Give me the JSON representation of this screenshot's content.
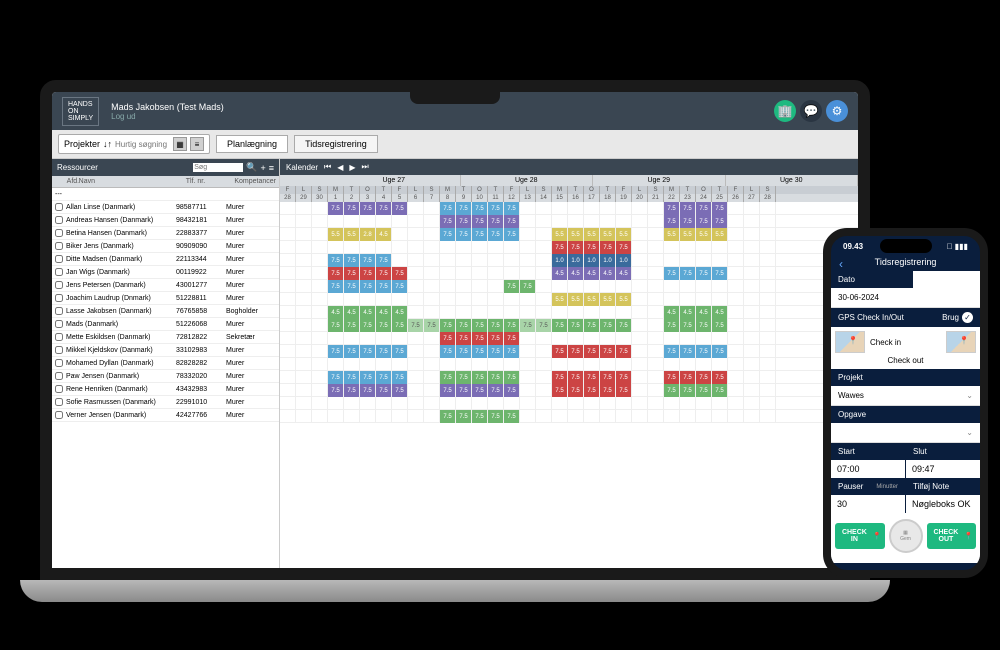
{
  "header": {
    "logo": "HANDS\nON\nSIMPLY",
    "user": "Mads Jakobsen (Test Mads)",
    "logout": "Log ud"
  },
  "tabs": {
    "projekter": "Projekter",
    "search_ph": "Hurtig søgning",
    "planlaegning": "Planlægning",
    "tidsregistrering": "Tidsregistrering"
  },
  "resources": {
    "title": "Ressourcer",
    "search_ph": "Søg",
    "cols": {
      "afd": "Afd.",
      "navn": "Navn",
      "tlf": "Tlf. nr.",
      "komp": "Kompetancer"
    },
    "rows": [
      {
        "n": "Allan Linse (Danmark)",
        "t": "98587711",
        "k": "Murer"
      },
      {
        "n": "Andreas Hansen (Danmark)",
        "t": "98432181",
        "k": "Murer"
      },
      {
        "n": "Betina Hansen (Danmark)",
        "t": "22883377",
        "k": "Murer"
      },
      {
        "n": "Biker Jens (Danmark)",
        "t": "90909090",
        "k": "Murer"
      },
      {
        "n": "Ditte Madsen (Danmark)",
        "t": "22113344",
        "k": "Murer"
      },
      {
        "n": "Jan Wigs (Danmark)",
        "t": "00119922",
        "k": "Murer"
      },
      {
        "n": "Jens Petersen (Danmark)",
        "t": "43001277",
        "k": "Murer"
      },
      {
        "n": "Joachim Laudrup (Dnmark)",
        "t": "51228811",
        "k": "Murer"
      },
      {
        "n": "Lasse Jakobsen (Danmark)",
        "t": "76765858",
        "k": "Bogholder"
      },
      {
        "n": "Mads (Danmark)",
        "t": "51226068",
        "k": "Murer"
      },
      {
        "n": "Mette Eskildsen (Danmark)",
        "t": "72812822",
        "k": "Sekretær"
      },
      {
        "n": "Mikkel Kjeldskov (Danmark)",
        "t": "33102983",
        "k": "Murer"
      },
      {
        "n": "Mohamed Dyllan (Danmark)",
        "t": "82828282",
        "k": "Murer"
      },
      {
        "n": "Paw Jensen (Danmark)",
        "t": "78332020",
        "k": "Murer"
      },
      {
        "n": "Rene Henriken (Danmark)",
        "t": "43432983",
        "k": "Murer"
      },
      {
        "n": "Sofie Rasmussen (Danmark)",
        "t": "22991010",
        "k": "Murer"
      },
      {
        "n": "Verner Jensen (Danmark)",
        "t": "42427766",
        "k": "Murer"
      }
    ]
  },
  "calendar": {
    "title": "Kalender",
    "weeks": [
      "Uge 27",
      "Uge 28",
      "Uge 29",
      "Uge 30"
    ],
    "daylabels": [
      "F",
      "L",
      "S",
      "M",
      "T",
      "O",
      "T",
      "F",
      "L",
      "S",
      "M",
      "T",
      "O",
      "T",
      "F",
      "L",
      "S",
      "M",
      "T",
      "O",
      "T",
      "F",
      "L",
      "S",
      "M",
      "T",
      "O",
      "T",
      "F",
      "L",
      "S"
    ],
    "daynums": [
      "28",
      "29",
      "30",
      "1",
      "2",
      "3",
      "4",
      "5",
      "6",
      "7",
      "8",
      "9",
      "10",
      "11",
      "12",
      "13",
      "14",
      "15",
      "16",
      "17",
      "18",
      "19",
      "20",
      "21",
      "22",
      "23",
      "24",
      "25",
      "26",
      "27",
      "28"
    ],
    "val": "7.5",
    "rows": [
      {
        "cells": [
          {
            "i": 3,
            "c": "p"
          },
          {
            "i": 4,
            "c": "p"
          },
          {
            "i": 5,
            "c": "p"
          },
          {
            "i": 6,
            "c": "p"
          },
          {
            "i": 7,
            "c": "p"
          },
          {
            "i": 10,
            "c": "b"
          },
          {
            "i": 11,
            "c": "b"
          },
          {
            "i": 12,
            "c": "b"
          },
          {
            "i": 13,
            "c": "b"
          },
          {
            "i": 14,
            "c": "b"
          },
          {
            "i": 24,
            "c": "p"
          },
          {
            "i": 25,
            "c": "p"
          },
          {
            "i": 26,
            "c": "p"
          },
          {
            "i": 27,
            "c": "p"
          }
        ]
      },
      {
        "cells": [
          {
            "i": 10,
            "c": "p"
          },
          {
            "i": 11,
            "c": "p"
          },
          {
            "i": 12,
            "c": "p"
          },
          {
            "i": 13,
            "c": "p"
          },
          {
            "i": 14,
            "c": "p"
          },
          {
            "i": 24,
            "c": "p"
          },
          {
            "i": 25,
            "c": "p"
          },
          {
            "i": 26,
            "c": "p"
          },
          {
            "i": 27,
            "c": "p"
          }
        ]
      },
      {
        "cells": [
          {
            "i": 3,
            "c": "y",
            "v": "5.5"
          },
          {
            "i": 4,
            "c": "y",
            "v": "5.5"
          },
          {
            "i": 5,
            "c": "y",
            "v": "2.8"
          },
          {
            "i": 6,
            "c": "y",
            "v": "4.5"
          },
          {
            "i": 10,
            "c": "b"
          },
          {
            "i": 11,
            "c": "b"
          },
          {
            "i": 12,
            "c": "b"
          },
          {
            "i": 13,
            "c": "b"
          },
          {
            "i": 14,
            "c": "b"
          },
          {
            "i": 17,
            "c": "y",
            "v": "5.5"
          },
          {
            "i": 18,
            "c": "y",
            "v": "5.5"
          },
          {
            "i": 19,
            "c": "y",
            "v": "5.5"
          },
          {
            "i": 20,
            "c": "y",
            "v": "5.5"
          },
          {
            "i": 21,
            "c": "y",
            "v": "5.5"
          },
          {
            "i": 24,
            "c": "y",
            "v": "5.5"
          },
          {
            "i": 25,
            "c": "y",
            "v": "5.5"
          },
          {
            "i": 26,
            "c": "y",
            "v": "5.5"
          },
          {
            "i": 27,
            "c": "y",
            "v": "5.5"
          }
        ]
      },
      {
        "cells": [
          {
            "i": 17,
            "c": "r"
          },
          {
            "i": 18,
            "c": "r"
          },
          {
            "i": 19,
            "c": "r"
          },
          {
            "i": 20,
            "c": "r"
          },
          {
            "i": 21,
            "c": "r"
          }
        ]
      },
      {
        "cells": [
          {
            "i": 3,
            "c": "b"
          },
          {
            "i": 4,
            "c": "b"
          },
          {
            "i": 5,
            "c": "b"
          },
          {
            "i": 6,
            "c": "b"
          },
          {
            "i": 17,
            "c": "db",
            "v": "1.0"
          },
          {
            "i": 18,
            "c": "db",
            "v": "1.0"
          },
          {
            "i": 19,
            "c": "db",
            "v": "1.0"
          },
          {
            "i": 20,
            "c": "db",
            "v": "1.0"
          },
          {
            "i": 21,
            "c": "db",
            "v": "1.0"
          }
        ]
      },
      {
        "cells": [
          {
            "i": 3,
            "c": "r"
          },
          {
            "i": 4,
            "c": "r"
          },
          {
            "i": 5,
            "c": "r"
          },
          {
            "i": 6,
            "c": "r"
          },
          {
            "i": 7,
            "c": "r"
          },
          {
            "i": 17,
            "c": "p",
            "v": "4.5"
          },
          {
            "i": 18,
            "c": "p",
            "v": "4.5"
          },
          {
            "i": 19,
            "c": "p",
            "v": "4.5"
          },
          {
            "i": 20,
            "c": "p",
            "v": "4.5"
          },
          {
            "i": 21,
            "c": "p",
            "v": "4.5"
          },
          {
            "i": 24,
            "c": "b"
          },
          {
            "i": 25,
            "c": "b"
          },
          {
            "i": 26,
            "c": "b"
          },
          {
            "i": 27,
            "c": "b"
          }
        ]
      },
      {
        "cells": [
          {
            "i": 3,
            "c": "b"
          },
          {
            "i": 4,
            "c": "b"
          },
          {
            "i": 5,
            "c": "b"
          },
          {
            "i": 6,
            "c": "b"
          },
          {
            "i": 7,
            "c": "b"
          },
          {
            "i": 14,
            "c": "g"
          },
          {
            "i": 15,
            "c": "g"
          }
        ]
      },
      {
        "cells": [
          {
            "i": 17,
            "c": "y",
            "v": "5.5"
          },
          {
            "i": 18,
            "c": "y",
            "v": "5.5"
          },
          {
            "i": 19,
            "c": "y",
            "v": "5.5"
          },
          {
            "i": 20,
            "c": "y",
            "v": "5.5"
          },
          {
            "i": 21,
            "c": "y",
            "v": "5.5"
          }
        ]
      },
      {
        "cells": [
          {
            "i": 3,
            "c": "g",
            "v": "4.5"
          },
          {
            "i": 4,
            "c": "g",
            "v": "4.5"
          },
          {
            "i": 5,
            "c": "g",
            "v": "4.5"
          },
          {
            "i": 6,
            "c": "g",
            "v": "4.5"
          },
          {
            "i": 7,
            "c": "g",
            "v": "4.5"
          },
          {
            "i": 24,
            "c": "g",
            "v": "4.5"
          },
          {
            "i": 25,
            "c": "g",
            "v": "4.5"
          },
          {
            "i": 26,
            "c": "g",
            "v": "4.5"
          },
          {
            "i": 27,
            "c": "g",
            "v": "4.5"
          }
        ]
      },
      {
        "cells": [
          {
            "i": 3,
            "c": "g"
          },
          {
            "i": 4,
            "c": "g"
          },
          {
            "i": 5,
            "c": "g"
          },
          {
            "i": 6,
            "c": "g"
          },
          {
            "i": 7,
            "c": "g"
          },
          {
            "i": 8,
            "c": "lg"
          },
          {
            "i": 9,
            "c": "lg"
          },
          {
            "i": 10,
            "c": "g"
          },
          {
            "i": 11,
            "c": "g"
          },
          {
            "i": 12,
            "c": "g"
          },
          {
            "i": 13,
            "c": "g"
          },
          {
            "i": 14,
            "c": "g"
          },
          {
            "i": 15,
            "c": "lg"
          },
          {
            "i": 16,
            "c": "lg"
          },
          {
            "i": 17,
            "c": "g"
          },
          {
            "i": 18,
            "c": "g"
          },
          {
            "i": 19,
            "c": "g"
          },
          {
            "i": 20,
            "c": "g"
          },
          {
            "i": 21,
            "c": "g"
          },
          {
            "i": 24,
            "c": "g"
          },
          {
            "i": 25,
            "c": "g"
          },
          {
            "i": 26,
            "c": "g"
          },
          {
            "i": 27,
            "c": "g"
          }
        ]
      },
      {
        "cells": [
          {
            "i": 10,
            "c": "r"
          },
          {
            "i": 11,
            "c": "r"
          },
          {
            "i": 12,
            "c": "r"
          },
          {
            "i": 13,
            "c": "r"
          },
          {
            "i": 14,
            "c": "r"
          }
        ]
      },
      {
        "cells": [
          {
            "i": 3,
            "c": "b"
          },
          {
            "i": 4,
            "c": "b"
          },
          {
            "i": 5,
            "c": "b"
          },
          {
            "i": 6,
            "c": "b"
          },
          {
            "i": 7,
            "c": "b"
          },
          {
            "i": 10,
            "c": "b"
          },
          {
            "i": 11,
            "c": "b"
          },
          {
            "i": 12,
            "c": "b"
          },
          {
            "i": 13,
            "c": "b"
          },
          {
            "i": 14,
            "c": "b"
          },
          {
            "i": 17,
            "c": "r"
          },
          {
            "i": 18,
            "c": "r"
          },
          {
            "i": 19,
            "c": "r"
          },
          {
            "i": 20,
            "c": "r"
          },
          {
            "i": 21,
            "c": "r"
          },
          {
            "i": 24,
            "c": "b"
          },
          {
            "i": 25,
            "c": "b"
          },
          {
            "i": 26,
            "c": "b"
          },
          {
            "i": 27,
            "c": "b"
          }
        ]
      },
      {
        "cells": []
      },
      {
        "cells": [
          {
            "i": 3,
            "c": "b"
          },
          {
            "i": 4,
            "c": "b"
          },
          {
            "i": 5,
            "c": "b"
          },
          {
            "i": 6,
            "c": "b"
          },
          {
            "i": 7,
            "c": "b"
          },
          {
            "i": 10,
            "c": "g"
          },
          {
            "i": 11,
            "c": "g"
          },
          {
            "i": 12,
            "c": "g"
          },
          {
            "i": 13,
            "c": "g"
          },
          {
            "i": 14,
            "c": "g"
          },
          {
            "i": 17,
            "c": "r"
          },
          {
            "i": 18,
            "c": "r"
          },
          {
            "i": 19,
            "c": "r"
          },
          {
            "i": 20,
            "c": "r"
          },
          {
            "i": 21,
            "c": "r"
          },
          {
            "i": 24,
            "c": "r"
          },
          {
            "i": 25,
            "c": "r"
          },
          {
            "i": 26,
            "c": "r"
          },
          {
            "i": 27,
            "c": "r"
          }
        ]
      },
      {
        "cells": [
          {
            "i": 3,
            "c": "p"
          },
          {
            "i": 4,
            "c": "p"
          },
          {
            "i": 5,
            "c": "p"
          },
          {
            "i": 6,
            "c": "p"
          },
          {
            "i": 7,
            "c": "p"
          },
          {
            "i": 10,
            "c": "p"
          },
          {
            "i": 11,
            "c": "p"
          },
          {
            "i": 12,
            "c": "p"
          },
          {
            "i": 13,
            "c": "p"
          },
          {
            "i": 14,
            "c": "p"
          },
          {
            "i": 17,
            "c": "r"
          },
          {
            "i": 18,
            "c": "r"
          },
          {
            "i": 19,
            "c": "r"
          },
          {
            "i": 20,
            "c": "r"
          },
          {
            "i": 21,
            "c": "r"
          },
          {
            "i": 24,
            "c": "g"
          },
          {
            "i": 25,
            "c": "g"
          },
          {
            "i": 26,
            "c": "g"
          },
          {
            "i": 27,
            "c": "g"
          }
        ]
      },
      {
        "cells": []
      },
      {
        "cells": [
          {
            "i": 10,
            "c": "g"
          },
          {
            "i": 11,
            "c": "g"
          },
          {
            "i": 12,
            "c": "g"
          },
          {
            "i": 13,
            "c": "g"
          },
          {
            "i": 14,
            "c": "g"
          }
        ]
      }
    ]
  },
  "phone": {
    "time": "09.43",
    "title": "Tidsregistrering",
    "dato_lbl": "Dato",
    "dato_val": "30-06-2024",
    "gps_lbl": "GPS Check In/Out",
    "brug": "Brug",
    "checkin": "Check in",
    "checkout": "Check out",
    "projekt_lbl": "Projekt",
    "projekt_val": "Wawes",
    "opgave_lbl": "Opgave",
    "start_lbl": "Start",
    "start_val": "07:00",
    "slut_lbl": "Slut",
    "slut_val": "09:47",
    "pauser_lbl": "Pauser",
    "pauser_sub": "Minutter",
    "pauser_val": "30",
    "note_lbl": "Tilføj Note",
    "note_val": "Nøgleboks OK",
    "btn_in": "CHECK IN",
    "btn_gem": "Gem",
    "btn_out": "CHECK OUT"
  }
}
